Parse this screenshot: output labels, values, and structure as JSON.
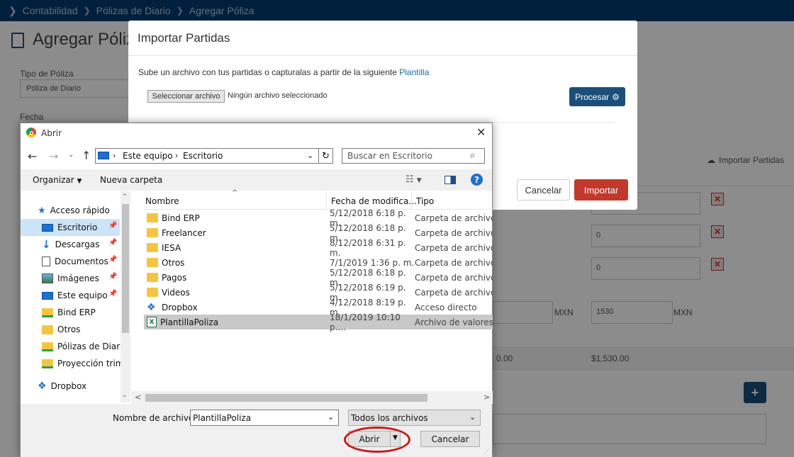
{
  "breadcrumb": [
    "Contabilidad",
    "Pólizas de Diario",
    "Agregar Póliza"
  ],
  "page": {
    "title": "Agregar Póliza",
    "tipo_label": "Tipo de Póliza",
    "tipo_value": "Póliza de Diario",
    "fecha_label": "Fecha",
    "importar_link": "Importar Partidas",
    "row_values": [
      "0",
      "0"
    ],
    "amount_1": "1530",
    "currency": "MXN",
    "total_left": "0.00",
    "total_right": "$1,530.00"
  },
  "modal": {
    "title": "Importar Partidas",
    "instructions": "Sube un archivo con tus partidas o capturalas a partir de la siguiente",
    "plantilla_link": "Plantilla",
    "file_button": "Seleccionar archivo",
    "file_status": "Ningún archivo seleccionado",
    "procesar": "Procesar",
    "cancelar": "Cancelar",
    "importar": "Importar"
  },
  "dialog": {
    "title": "Abrir",
    "path": [
      "Este equipo",
      "Escritorio"
    ],
    "search_placeholder": "Buscar en Escritorio",
    "organizar": "Organizar",
    "nueva_carpeta": "Nueva carpeta",
    "nav": [
      {
        "label": "Acceso rápido",
        "icon": "star-icon"
      },
      {
        "label": "Escritorio",
        "icon": "desktop-icon",
        "selected": true
      },
      {
        "label": "Descargas",
        "icon": "download-icon"
      },
      {
        "label": "Documentos",
        "icon": "document-icon"
      },
      {
        "label": "Imágenes",
        "icon": "image-icon"
      },
      {
        "label": "Este equipo",
        "icon": "computer-icon"
      },
      {
        "label": "Bind ERP",
        "icon": "folder-sync-icon"
      },
      {
        "label": "Otros",
        "icon": "folder-icon"
      },
      {
        "label": "Pólizas de Diario",
        "icon": "folder-sync-icon"
      },
      {
        "label": "Proyección trim",
        "icon": "folder-sync-icon"
      },
      {
        "label": "Dropbox",
        "icon": "dropbox-icon"
      }
    ],
    "columns": [
      "Nombre",
      "Fecha de modifica...",
      "Tipo"
    ],
    "files": [
      {
        "name": "Bind ERP",
        "date": "5/12/2018 6:18 p. m.",
        "type": "Carpeta de archivos",
        "icon": "folder-icon"
      },
      {
        "name": "Freelancer",
        "date": "5/12/2018 6:18 p. m.",
        "type": "Carpeta de archivos",
        "icon": "folder-icon"
      },
      {
        "name": "IESA",
        "date": "8/12/2018 6:31 p. m.",
        "type": "Carpeta de archivos",
        "icon": "folder-icon"
      },
      {
        "name": "Otros",
        "date": "7/1/2019 1:36 p. m.",
        "type": "Carpeta de archivos",
        "icon": "folder-icon"
      },
      {
        "name": "Pagos",
        "date": "5/12/2018 6:18 p. m.",
        "type": "Carpeta de archivos",
        "icon": "folder-icon"
      },
      {
        "name": "Videos",
        "date": "5/12/2018 6:19 p. m.",
        "type": "Carpeta de archivos",
        "icon": "folder-icon"
      },
      {
        "name": "Dropbox",
        "date": "4/12/2018 8:19 p. m.",
        "type": "Acceso directo",
        "icon": "dropbox-icon"
      },
      {
        "name": "PlantillaPoliza",
        "date": "18/1/2019 10:10 p....",
        "type": "Archivo de valores...",
        "icon": "excel-icon",
        "selected": true
      }
    ],
    "filename_label": "Nombre de archivo:",
    "filename_value": "PlantillaPoliza",
    "filter": "Todos los archivos",
    "abrir": "Abrir",
    "cancelar": "Cancelar"
  }
}
